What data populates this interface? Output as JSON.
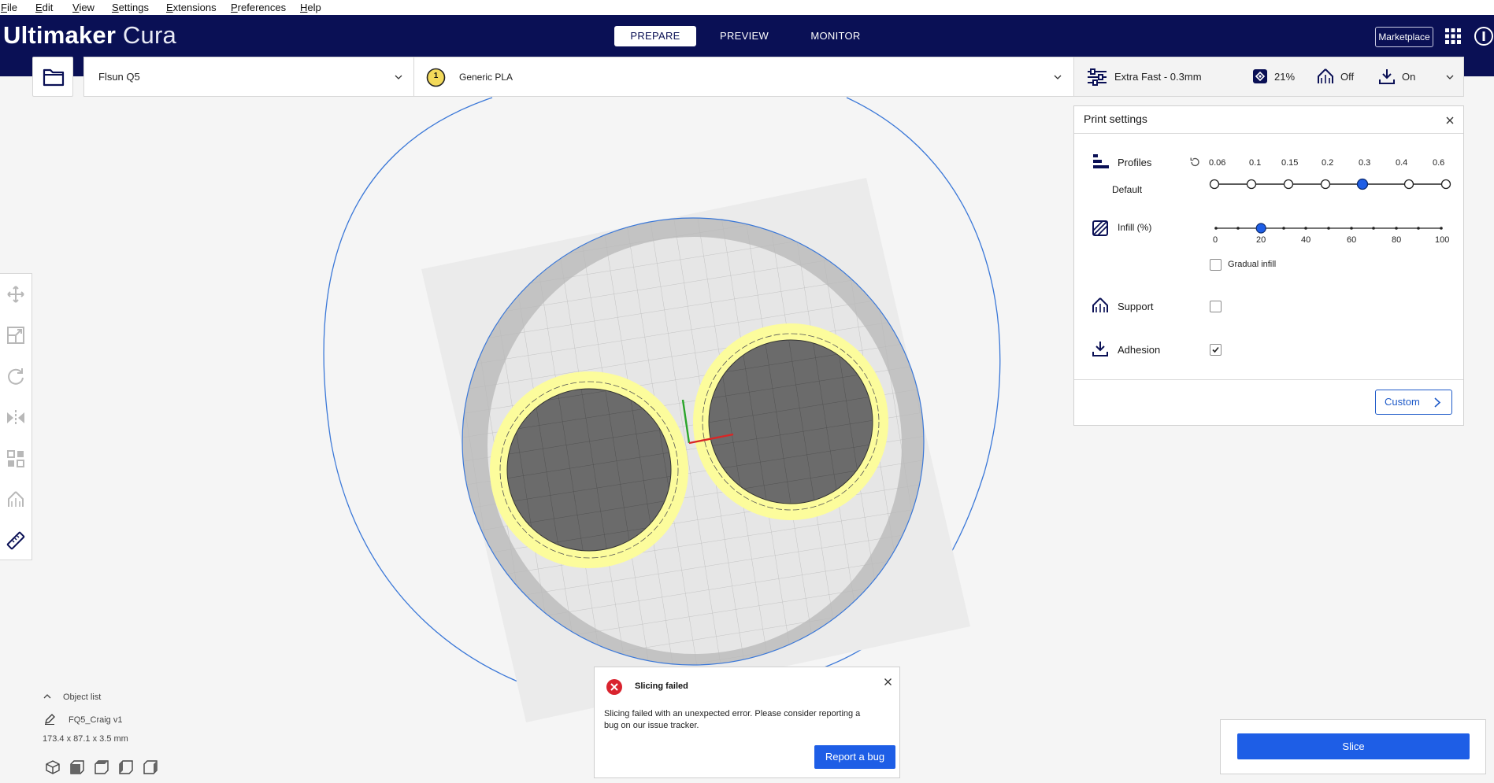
{
  "menu": [
    "File",
    "Edit",
    "View",
    "Settings",
    "Extensions",
    "Preferences",
    "Help"
  ],
  "brand": {
    "bold": "Ultimaker",
    "light": "Cura"
  },
  "stages": {
    "prepare": "PREPARE",
    "preview": "PREVIEW",
    "monitor": "MONITOR",
    "active": "PREPARE"
  },
  "header": {
    "marketplace": "Marketplace"
  },
  "machine": {
    "name": "Flsun Q5"
  },
  "material": {
    "extruder": "1",
    "name": "Generic PLA"
  },
  "summary": {
    "profile": "Extra Fast - 0.3mm",
    "infill": "21%",
    "support": "Off",
    "adhesion": "On"
  },
  "print_settings": {
    "title": "Print settings",
    "profiles_label": "Profiles",
    "profile_default": "Default",
    "layer_heights": [
      "0.06",
      "0.1",
      "0.15",
      "0.2",
      "0.3",
      "0.4",
      "0.6"
    ],
    "selected_layer_height": "0.3",
    "infill_label": "Infill (%)",
    "infill_ticks": [
      "0",
      "20",
      "40",
      "60",
      "80",
      "100"
    ],
    "infill_value": 20,
    "gradual_infill": "Gradual infill",
    "gradual_checked": false,
    "support_label": "Support",
    "support_checked": false,
    "adhesion_label": "Adhesion",
    "adhesion_checked": true,
    "custom_button": "Custom"
  },
  "object_list": {
    "header": "Object list",
    "object_name": "FQ5_Craig v1",
    "dimensions": "173.4 x 87.1 x 3.5 mm"
  },
  "toast": {
    "title": "Slicing failed",
    "message_line1": "Slicing failed with an unexpected error. Please consider reporting a",
    "message_line2": "bug on our issue tracker.",
    "button": "Report a bug"
  },
  "slice": {
    "button": "Slice"
  },
  "colors": {
    "header_bg": "#0a1055",
    "accent_blue": "#1e5ee6",
    "model_yellow": "#fcfc9c",
    "build_plate": "#ececec",
    "error_red": "#d9232e"
  }
}
